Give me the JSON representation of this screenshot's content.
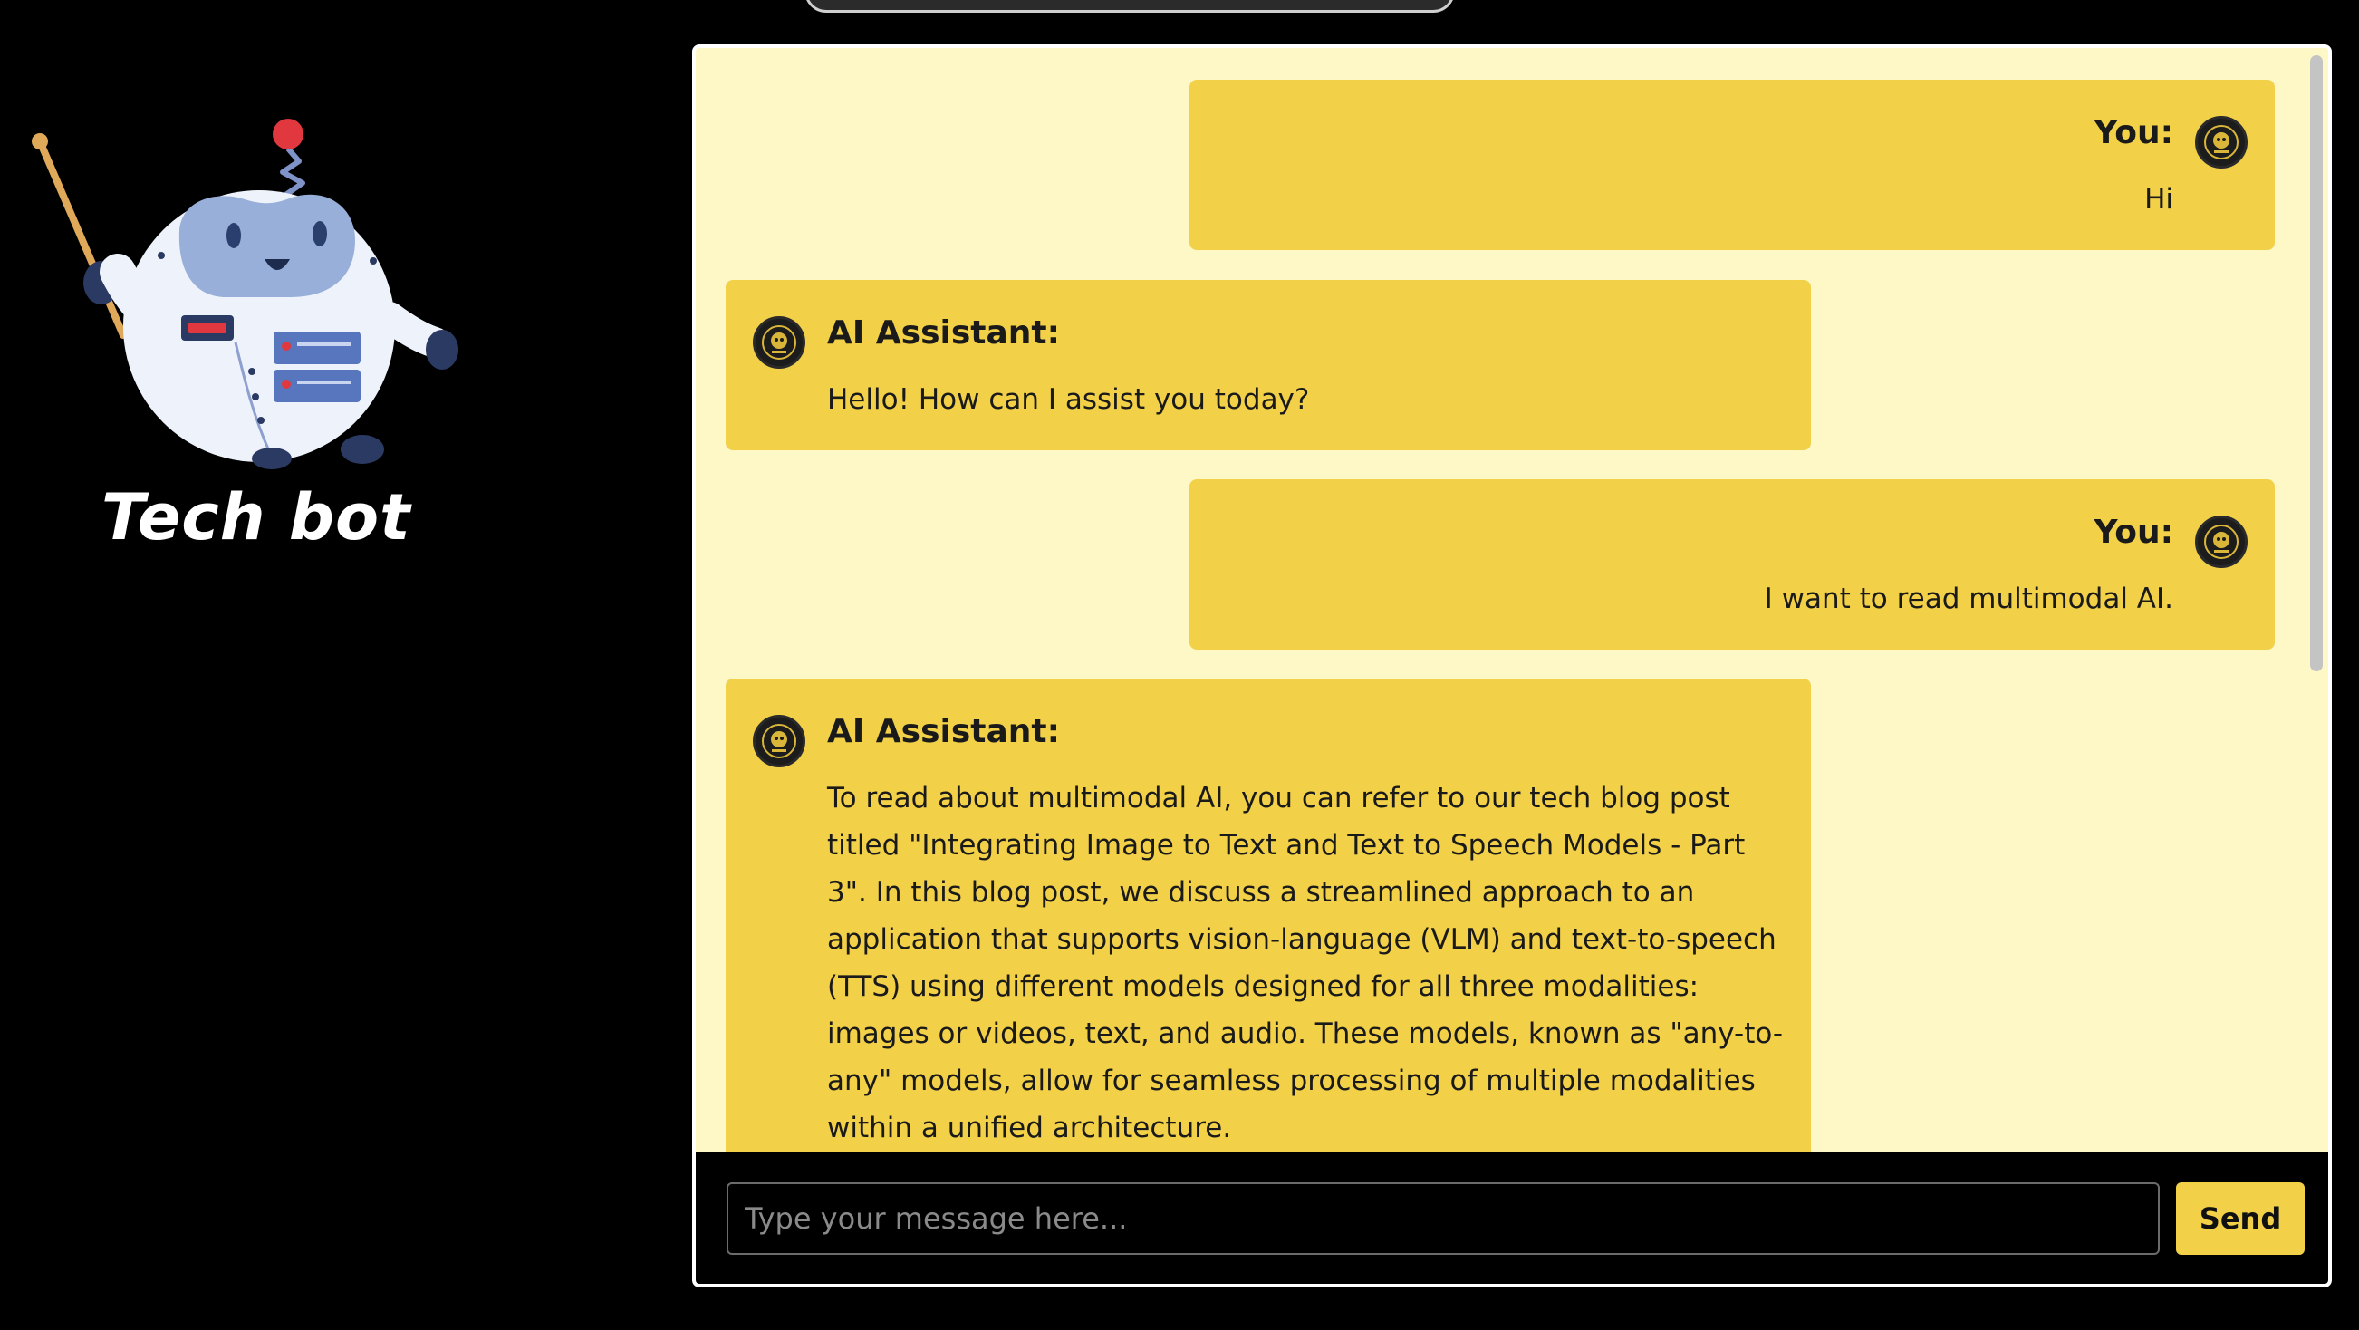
{
  "app": {
    "title": "Tech bot"
  },
  "colors": {
    "background": "#000000",
    "chat_background": "#fdf8c6",
    "bubble": "#f2d048",
    "text": "#1a1a1a"
  },
  "messages": [
    {
      "role": "user",
      "sender": "You:",
      "text": "Hi"
    },
    {
      "role": "ai",
      "sender": "AI Assistant:",
      "text": "Hello! How can I assist you today?"
    },
    {
      "role": "user",
      "sender": "You:",
      "text": "I want to read multimodal AI."
    },
    {
      "role": "ai",
      "sender": "AI Assistant:",
      "text": "To read about multimodal AI, you can refer to our tech blog post titled \"Integrating Image to Text and Text to Speech Models - Part 3\". In this blog post, we discuss a streamlined approach to an application that supports vision-language (VLM) and text-to-speech (TTS) using different models designed for all three modalities: images or videos, text, and audio. These models, known as \"any-to-any\" models, allow for seamless processing of multiple modalities within a unified architecture."
    }
  ],
  "composer": {
    "placeholder": "Type your message here...",
    "value": "",
    "send_label": "Send"
  },
  "icons": {
    "mascot": "robot-mascot-icon",
    "avatar": "avatar-icon"
  }
}
